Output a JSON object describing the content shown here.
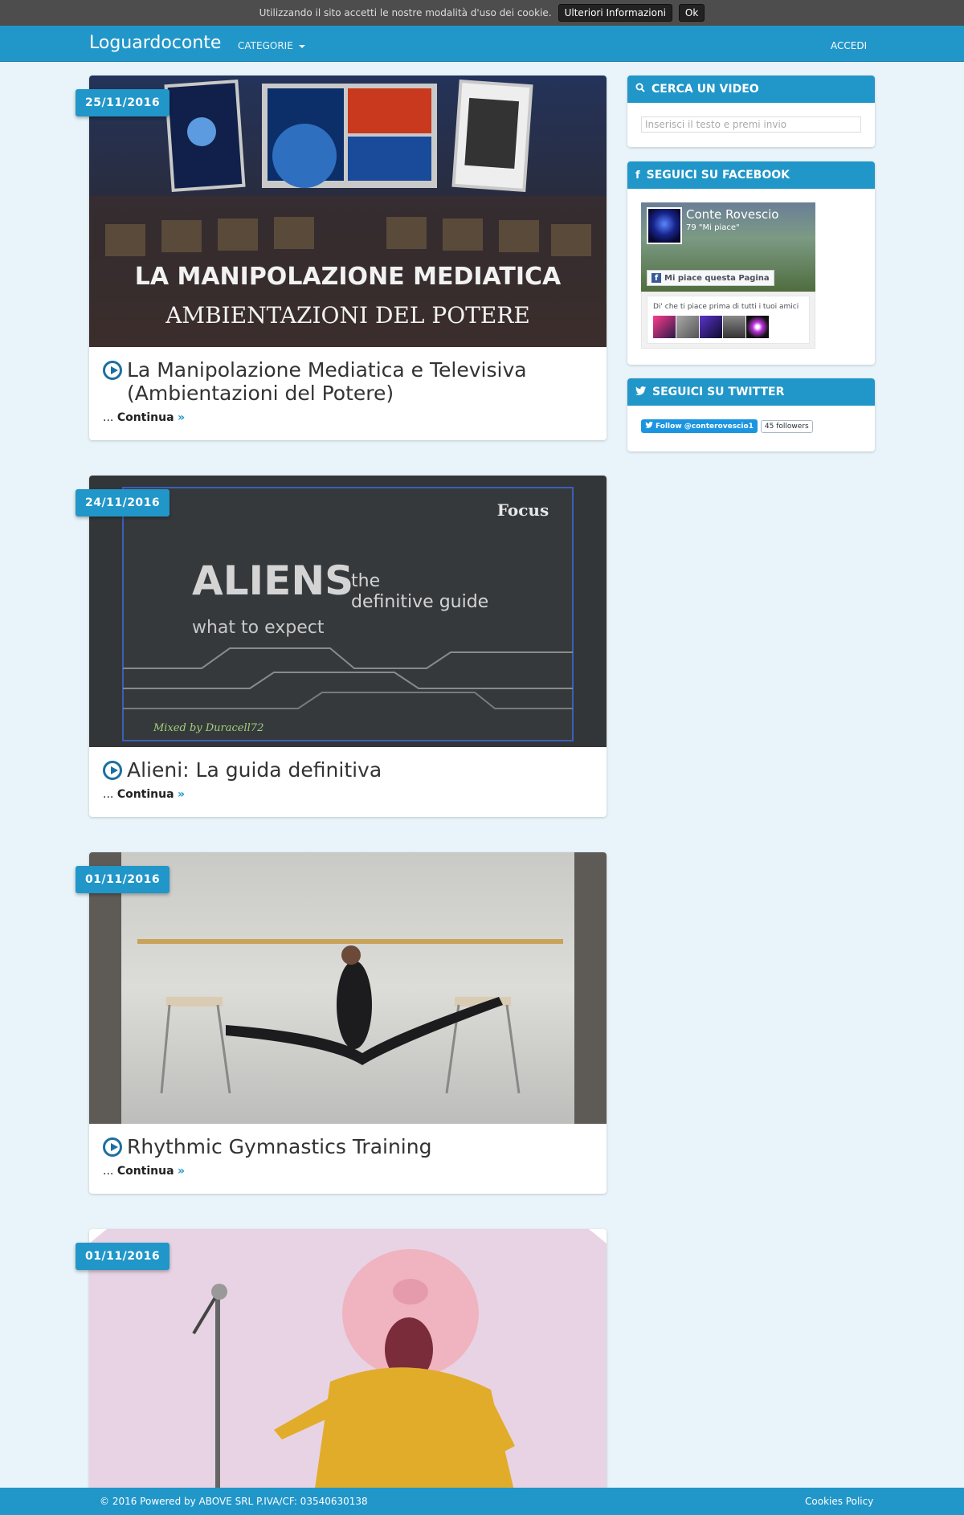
{
  "cookie_bar": {
    "text": "Utilizzando il sito accetti le nostre modalità d'uso dei cookie.",
    "more_label": "Ulteriori Informazioni",
    "ok_label": "Ok"
  },
  "navbar": {
    "brand": "Loguardoconte",
    "categories_label": "CATEGORIE",
    "login_label": "ACCEDI"
  },
  "posts": [
    {
      "date": "25/11/2016",
      "title": "La Manipolazione Mediatica e Televisiva (Ambientazioni del Potere)",
      "image_text_line1": "LA MANIPOLAZIONE MEDIATICA",
      "image_text_line2": "AMBIENTAZIONI DEL POTERE",
      "continue_prefix": "... ",
      "continue_label": "Continua"
    },
    {
      "date": "24/11/2016",
      "title": "Alieni: La guida definitiva",
      "image_brand": "Focus",
      "image_headline": "ALIENS",
      "image_sub1": "the",
      "image_sub2": "definitive guide",
      "image_tagline": "what to expect",
      "image_credit": "Mixed by Duracell72",
      "continue_prefix": "... ",
      "continue_label": "Continua"
    },
    {
      "date": "01/11/2016",
      "title": "Rhythmic Gymnastics Training",
      "continue_prefix": "... ",
      "continue_label": "Continua"
    },
    {
      "date": "01/11/2016"
    }
  ],
  "sidebar": {
    "search": {
      "title": "CERCA UN VIDEO",
      "placeholder": "Inserisci il testo e premi invio"
    },
    "facebook": {
      "title": "SEGUICI SU FACEBOOK",
      "page_name": "Conte Rovescio",
      "likes": "79 \"Mi piace\"",
      "like_button": "Mi piace questa Pagina",
      "friends_text": "Di' che ti piace prima di tutti i tuoi amici"
    },
    "twitter": {
      "title": "SEGUICI SU TWITTER",
      "follow_button": "Follow @conterovescio1",
      "followers": "45 followers"
    }
  },
  "footer": {
    "copyright": "© 2016 Powered by ABOVE SRL P.IVA/CF: 03540630138",
    "cookies_link": "Cookies Policy"
  },
  "colors": {
    "accent": "#2196c9",
    "background": "#e8f4fa",
    "play_icon": "#1c6fa2"
  }
}
